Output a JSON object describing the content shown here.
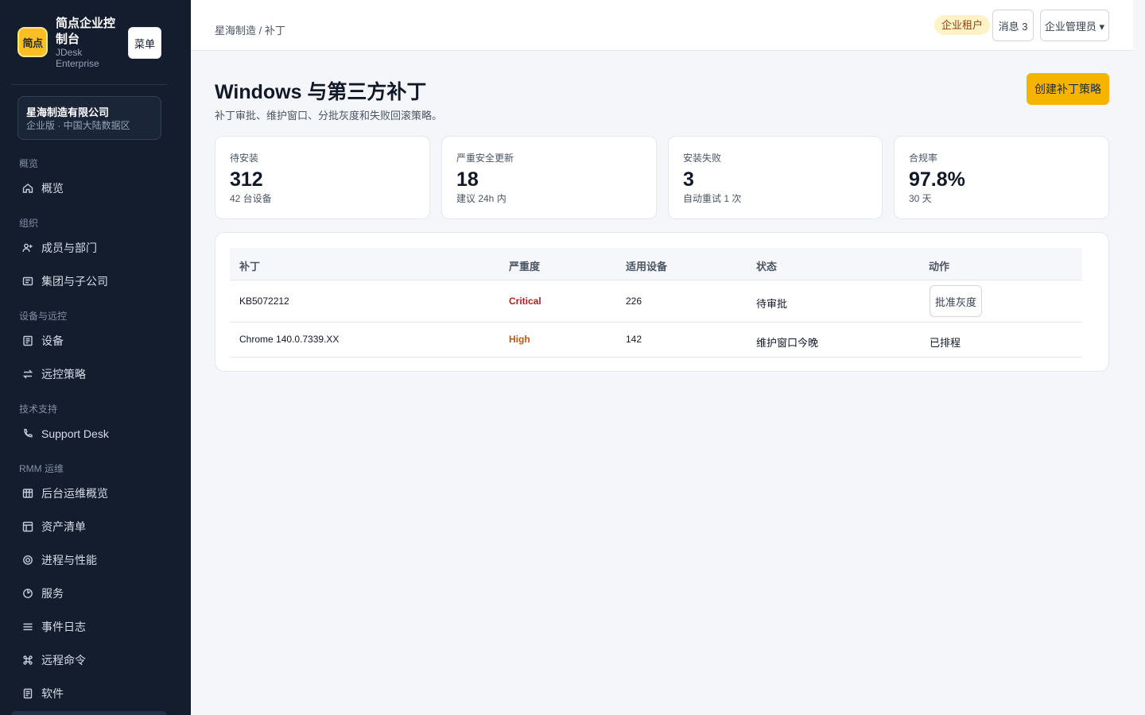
{
  "sidebar": {
    "logo_text": "简点",
    "brand_title": "简点企业控制台",
    "brand_sub": "JDesk Enterprise",
    "menu_label": "菜单",
    "org": {
      "name": "星海制造有限公司",
      "meta": "企业版 · 中国大陆数据区"
    },
    "sections": {
      "overview": "概览",
      "org": "组织",
      "devices": "设备与远控",
      "support": "技术支持",
      "rmm": "RMM 运维"
    },
    "items": [
      {
        "label": "概览",
        "icon": "home-icon"
      },
      {
        "label": "成员与部门",
        "icon": "user-add-icon"
      },
      {
        "label": "集团与子公司",
        "icon": "building-icon"
      },
      {
        "label": "设备",
        "icon": "device-icon"
      },
      {
        "label": "远控策略",
        "icon": "arrows-swap-icon"
      },
      {
        "label": "Support Desk",
        "icon": "phone-icon"
      },
      {
        "label": "后台运维概览",
        "icon": "grid-icon"
      },
      {
        "label": "资产清单",
        "icon": "layout-icon"
      },
      {
        "label": "进程与性能",
        "icon": "target-icon"
      },
      {
        "label": "服务",
        "icon": "gauge-icon"
      },
      {
        "label": "事件日志",
        "icon": "list-icon"
      },
      {
        "label": "远程命令",
        "icon": "command-icon"
      },
      {
        "label": "软件",
        "icon": "document-icon"
      }
    ]
  },
  "header": {
    "breadcrumb": "星海制造 / 补丁",
    "tenant_badge": "企业租户",
    "messages_label": "消息 3",
    "admin_label": "企业管理员 ▾"
  },
  "main": {
    "title": "Windows 与第三方补丁",
    "subtitle": "补丁审批、维护窗口、分批灰度和失败回滚策略。",
    "create_button": "创建补丁策略",
    "stats": [
      {
        "label": "待安装",
        "value": "312",
        "note": "42 台设备"
      },
      {
        "label": "严重安全更新",
        "value": "18",
        "note": "建议 24h 内"
      },
      {
        "label": "安装失败",
        "value": "3",
        "note": "自动重试 1 次"
      },
      {
        "label": "合规率",
        "value": "97.8%",
        "note": "30 天"
      }
    ],
    "table": {
      "columns": [
        "补丁",
        "严重度",
        "适用设备",
        "状态",
        "动作"
      ],
      "rows": [
        {
          "patch": "KB5072212",
          "severity": "Critical",
          "devices": "226",
          "status": "待审批",
          "action": "批准灰度"
        },
        {
          "patch": "Chrome 140.0.7339.XX",
          "severity": "High",
          "devices": "142",
          "status": "维护窗口今晚",
          "action": "已排程"
        }
      ]
    }
  },
  "colors": {
    "sidebar_bg": "#141d2e",
    "accent": "#f5b400",
    "critical": "#b91c1c",
    "high": "#c2570c",
    "badge_bg": "#fef3c7"
  }
}
